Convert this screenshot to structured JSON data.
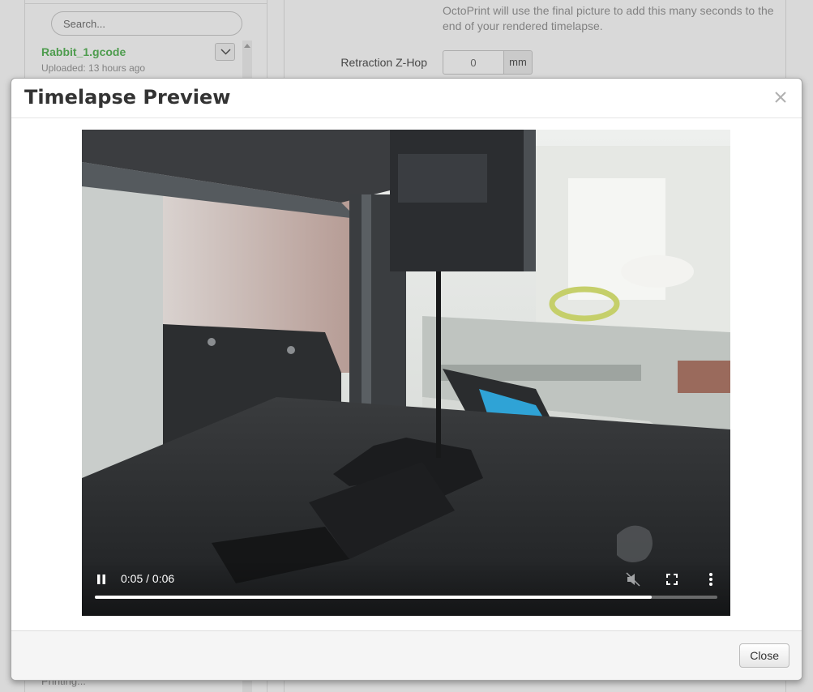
{
  "background": {
    "search": {
      "placeholder": "Search..."
    },
    "file": {
      "name": "Rabbit_1.gcode",
      "uploaded": "Uploaded: 13 hours ago"
    },
    "printing_label": "Printing...",
    "help_text": "OctoPrint will use the final picture to add this many seconds to the end of your rendered timelapse.",
    "retraction": {
      "label": "Retraction Z-Hop",
      "value": "0",
      "unit": "mm"
    }
  },
  "modal": {
    "title": "Timelapse Preview",
    "close_label": "Close",
    "video": {
      "time": "0:05 / 0:06",
      "progress": 0.894,
      "playing": true
    }
  },
  "colors": {
    "file_name": "#5cb85c",
    "footer_bg": "#f5f5f5",
    "lcd_screen": "#2fa3d6"
  },
  "icons": [
    "chevron-down-icon",
    "close-icon",
    "pause-icon",
    "mute-icon",
    "fullscreen-icon",
    "more-vert-icon"
  ]
}
